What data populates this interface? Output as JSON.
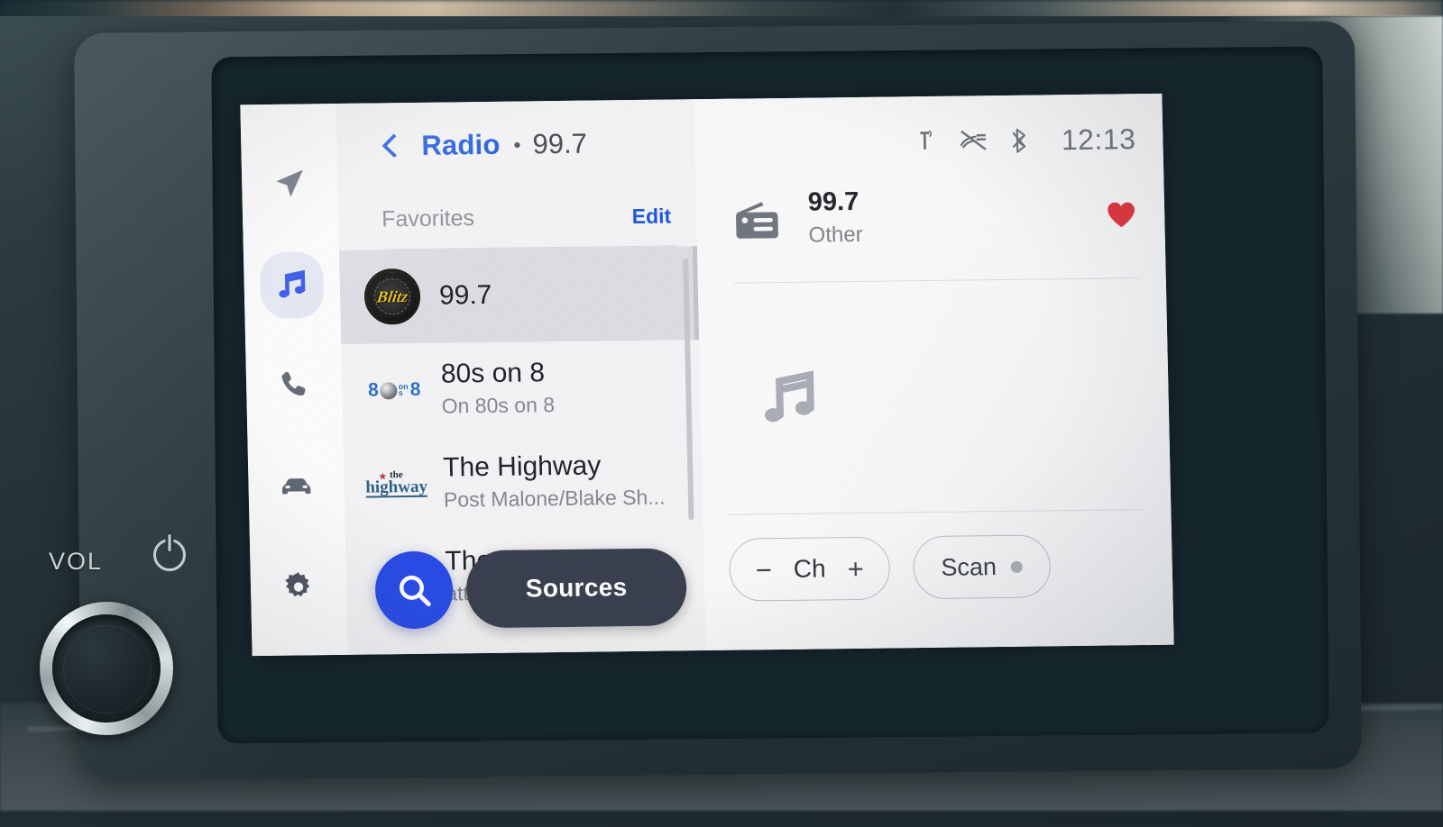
{
  "hardware": {
    "vol_label": "VOL",
    "power_icon": "power-icon",
    "knob_name": "volume-knob"
  },
  "sidebar": {
    "items": [
      {
        "id": "navigation",
        "icon": "navigation-arrow-icon",
        "active": false
      },
      {
        "id": "media",
        "icon": "music-note-icon",
        "active": true
      },
      {
        "id": "phone",
        "icon": "phone-icon",
        "active": false
      },
      {
        "id": "vehicle",
        "icon": "car-icon",
        "active": false
      },
      {
        "id": "settings",
        "icon": "gear-icon",
        "active": false
      }
    ],
    "active_accent": "#2649e8",
    "active_pill_bg": "#e3e7f3"
  },
  "header": {
    "back_icon": "chevron-left-icon",
    "title": "Radio",
    "separator": "•",
    "frequency": "99.7",
    "accent": "#1a56db"
  },
  "favorites": {
    "label": "Favorites",
    "edit_label": "Edit",
    "items": [
      {
        "title": "99.7",
        "subtitle": "",
        "logo": "blitz-station-logo",
        "logo_text": "Blitz",
        "selected": true
      },
      {
        "title": "80s on 8",
        "subtitle": "On 80s on 8",
        "logo": "80s-on-8-logo",
        "logo_text": "8",
        "logo_text2": "8",
        "logo_small_top": "on",
        "logo_small_bottom": "s",
        "selected": false
      },
      {
        "title": "The Highway",
        "subtitle": "Post Malone/Blake Sh...",
        "logo": "the-highway-logo",
        "logo_the": "the",
        "logo_main": "highway",
        "selected": false
      },
      {
        "title": "The",
        "subtitle": "att",
        "logo": "station-logo",
        "selected": false
      }
    ]
  },
  "actions": {
    "search_icon": "search-icon",
    "sources_label": "Sources"
  },
  "status_bar": {
    "icons": [
      {
        "name": "wireless-charging-icon"
      },
      {
        "name": "driver-attention-off-icon"
      },
      {
        "name": "bluetooth-icon"
      }
    ],
    "time": "12:13"
  },
  "now_playing": {
    "source_icon": "radio-icon",
    "title": "99.7",
    "subtitle": "Other",
    "favorite_icon": "heart-filled-icon",
    "favorite_color": "#e0262f",
    "artwork_placeholder_icon": "music-note-icon"
  },
  "player_controls": {
    "channel_down": "−",
    "channel_label": "Ch",
    "channel_up": "+",
    "scan_label": "Scan",
    "scan_indicator": "scan-dot"
  }
}
